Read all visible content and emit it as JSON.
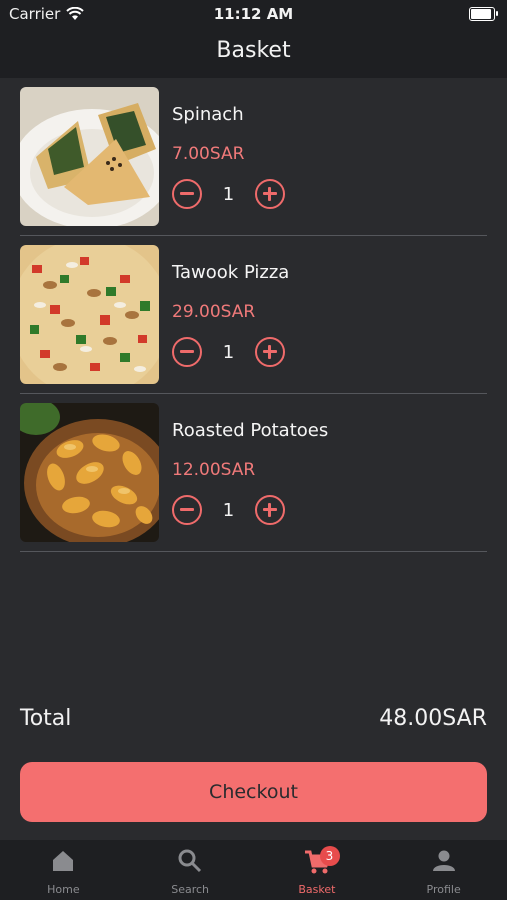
{
  "status_bar": {
    "carrier": "Carrier",
    "time": "11:12 AM"
  },
  "header": {
    "title": "Basket"
  },
  "items": [
    {
      "name": "Spinach",
      "price": "7.00SAR",
      "quantity": "1",
      "image": "spinach-pastry"
    },
    {
      "name": "Tawook Pizza",
      "price": "29.00SAR",
      "quantity": "1",
      "image": "pizza"
    },
    {
      "name": "Roasted Potatoes",
      "price": "12.00SAR",
      "quantity": "1",
      "image": "roasted-potatoes"
    }
  ],
  "summary": {
    "total_label": "Total",
    "total_value": "48.00SAR"
  },
  "checkout": {
    "label": "Checkout"
  },
  "tab_bar": {
    "tabs": [
      {
        "label": "Home",
        "icon": "home-icon"
      },
      {
        "label": "Search",
        "icon": "search-icon"
      },
      {
        "label": "Basket",
        "icon": "cart-icon",
        "badge": "3",
        "active": true
      },
      {
        "label": "Profile",
        "icon": "person-icon"
      }
    ]
  },
  "colors": {
    "accent": "#f46f6f",
    "background": "#2a2b2e",
    "bar": "#1e1f22"
  }
}
